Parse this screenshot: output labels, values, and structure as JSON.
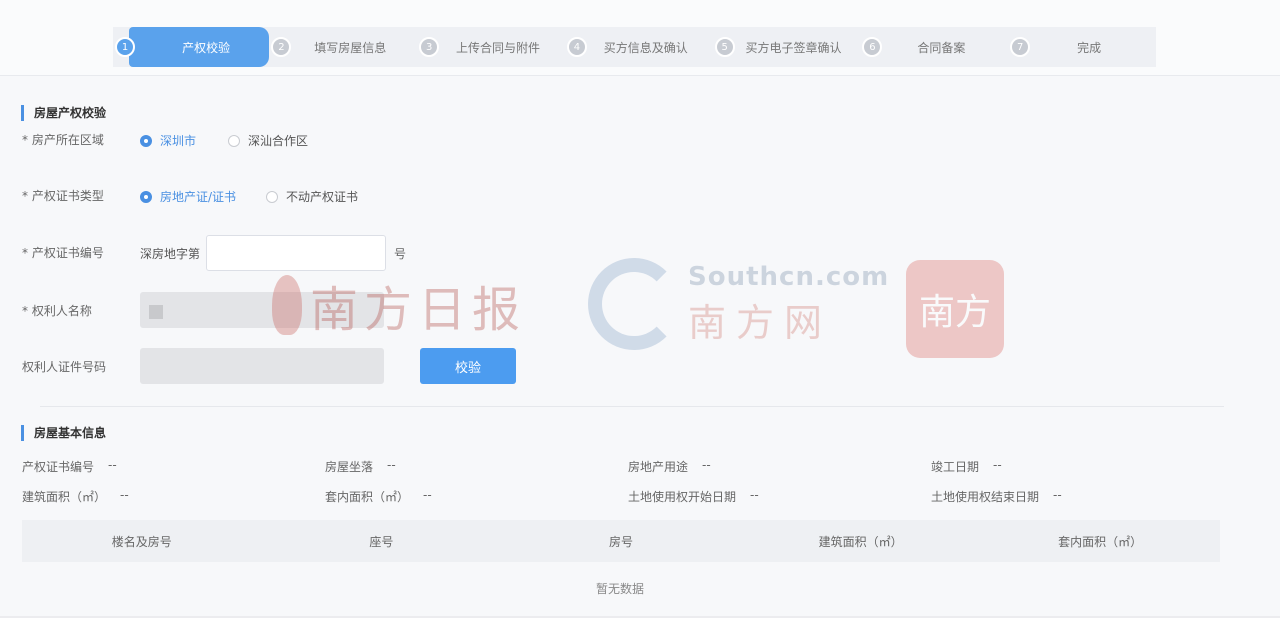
{
  "steps": [
    {
      "num": "1",
      "label": "产权校验"
    },
    {
      "num": "2",
      "label": "填写房屋信息"
    },
    {
      "num": "3",
      "label": "上传合同与附件"
    },
    {
      "num": "4",
      "label": "买方信息及确认"
    },
    {
      "num": "5",
      "label": "买方电子签章确认"
    },
    {
      "num": "6",
      "label": "合同备案"
    },
    {
      "num": "7",
      "label": "完成"
    }
  ],
  "section1": {
    "title": "房屋产权校验",
    "region_label": "* 房产所在区域",
    "region_options": [
      "深圳市",
      "深汕合作区"
    ],
    "cert_type_label": "* 产权证书类型",
    "cert_type_options": [
      "房地产证/证书",
      "不动产权证书"
    ],
    "cert_no_label": "* 产权证书编号",
    "cert_prefix": "深房地字第",
    "cert_suffix": "号",
    "owner_name_label": "* 权利人名称",
    "owner_id_label": "权利人证件号码",
    "verify_button": "校验"
  },
  "section2": {
    "title": "房屋基本信息",
    "fields": [
      {
        "label": "产权证书编号",
        "value": "--"
      },
      {
        "label": "房屋坐落",
        "value": "--"
      },
      {
        "label": "房地产用途",
        "value": "--"
      },
      {
        "label": "竣工日期",
        "value": "--"
      },
      {
        "label": "建筑面积（㎡）",
        "value": "--"
      },
      {
        "label": "套内面积（㎡）",
        "value": "--"
      },
      {
        "label": "土地使用权开始日期",
        "value": "--"
      },
      {
        "label": "土地使用权结束日期",
        "value": "--"
      }
    ],
    "table_headers": [
      "楼名及房号",
      "座号",
      "房号",
      "建筑面积（㎡）",
      "套内面积（㎡）"
    ],
    "empty_text": "暂无数据"
  },
  "watermark": {
    "paper_name": "南方日报",
    "site": "Southcn.com",
    "site_name": "南方网",
    "logo_text": "南方"
  },
  "colors": {
    "accent": "#4a90e2",
    "button": "#4c9cf0"
  }
}
